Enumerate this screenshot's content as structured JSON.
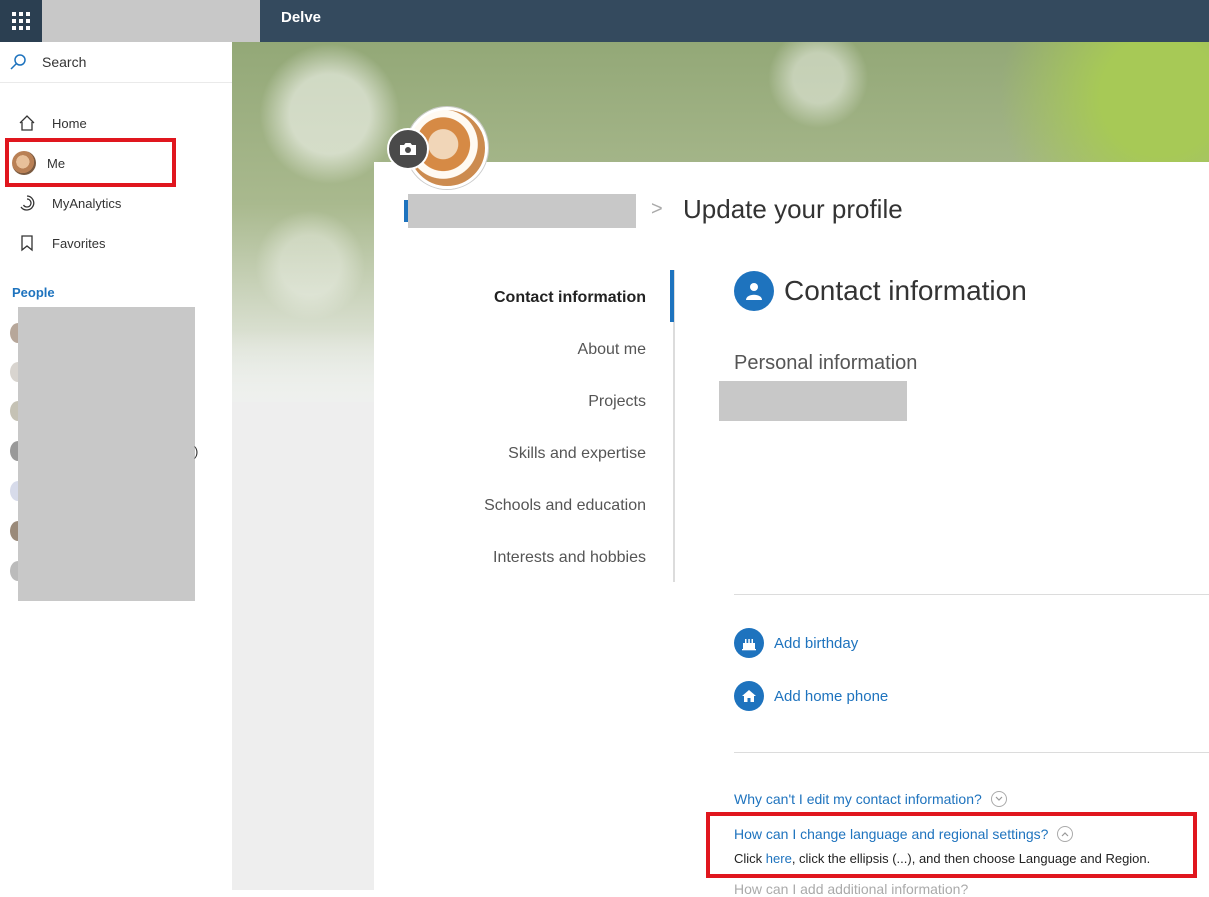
{
  "topbar": {
    "app_title": "Delve"
  },
  "sidebar": {
    "search_label": "Search",
    "nav": [
      {
        "label": "Home",
        "icon": "home-icon"
      },
      {
        "label": "Me",
        "icon": "avatar"
      },
      {
        "label": "MyAnalytics",
        "icon": "analytics-icon"
      },
      {
        "label": "Favorites",
        "icon": "bookmark-icon"
      }
    ],
    "people_heading": "People",
    "people_tail": ")"
  },
  "profile": {
    "breadcrumb_sep": ">",
    "page_title": "Update your profile"
  },
  "tabs": [
    "Contact information",
    "About me",
    "Projects",
    "Skills and expertise",
    "Schools and education",
    "Interests and hobbies"
  ],
  "content": {
    "section_title": "Contact information",
    "personal_info": "Personal information",
    "add_birthday": "Add birthday",
    "add_home_phone": "Add home phone",
    "faq_edit": "Why can't I edit my contact information?",
    "faq_language": "How can I change language and regional settings?",
    "answer_prefix": "Click ",
    "answer_link": "here",
    "answer_suffix": ", click the ellipsis (...), and then choose Language and Region.",
    "next_faq_cut": "How can I add additional information?"
  },
  "colors": {
    "accent": "#1e73be",
    "topbar": "#344a5e",
    "highlight": "#e0161e"
  }
}
